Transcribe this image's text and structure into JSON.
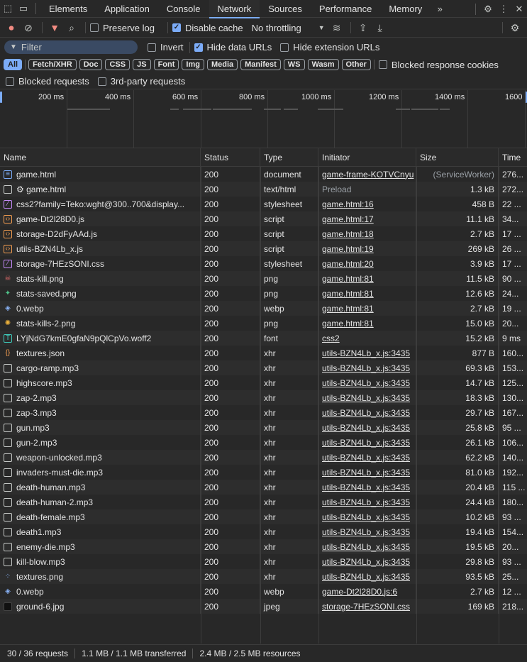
{
  "devtools": {
    "tabs": [
      "Elements",
      "Application",
      "Console",
      "Network",
      "Sources",
      "Performance",
      "Memory"
    ],
    "active_tab": "Network",
    "more_tabs_icon": "»"
  },
  "toolbar": {
    "preserve_log": "Preserve log",
    "disable_cache": "Disable cache",
    "throttling": "No throttling"
  },
  "filter": {
    "placeholder": "Filter",
    "invert": "Invert",
    "hide_data_urls": "Hide data URLs",
    "hide_extension_urls": "Hide extension URLs"
  },
  "type_filters": [
    "All",
    "Fetch/XHR",
    "Doc",
    "CSS",
    "JS",
    "Font",
    "Img",
    "Media",
    "Manifest",
    "WS",
    "Wasm",
    "Other"
  ],
  "blocked_response_cookies": "Blocked response cookies",
  "blocked_requests": "Blocked requests",
  "third_party_requests": "3rd-party requests",
  "timeline": {
    "ticks": [
      "200 ms",
      "400 ms",
      "600 ms",
      "800 ms",
      "1000 ms",
      "1200 ms",
      "1400 ms",
      "1600"
    ]
  },
  "columns": {
    "name": "Name",
    "status": "Status",
    "type": "Type",
    "initiator": "Initiator",
    "size": "Size",
    "time": "Time"
  },
  "requests": [
    {
      "icon": "document-icon",
      "name": "game.html",
      "status": "200",
      "type": "document",
      "initiator": "game-frame-KOTVCnyu",
      "initiator_link": true,
      "size": "(ServiceWorker)",
      "size_muted": true,
      "time": "276..."
    },
    {
      "icon": "gear-icon",
      "name": "⚙ game.html",
      "status": "200",
      "type": "text/html",
      "initiator": "Preload",
      "initiator_link": false,
      "size": "1.3 kB",
      "size_muted": false,
      "time": "272..."
    },
    {
      "icon": "stylesheet-icon",
      "name": "css2?family=Teko:wght@300..700&display...",
      "status": "200",
      "type": "stylesheet",
      "initiator": "game.html:16",
      "initiator_link": true,
      "size": "458 B",
      "size_muted": false,
      "time": "22 ..."
    },
    {
      "icon": "script-icon",
      "name": "game-Dt2l28D0.js",
      "status": "200",
      "type": "script",
      "initiator": "game.html:17",
      "initiator_link": true,
      "size": "11.1 kB",
      "size_muted": false,
      "time": "34..."
    },
    {
      "icon": "script-icon",
      "name": "storage-D2dFyAAd.js",
      "status": "200",
      "type": "script",
      "initiator": "game.html:18",
      "initiator_link": true,
      "size": "2.7 kB",
      "size_muted": false,
      "time": "17 ..."
    },
    {
      "icon": "script-icon",
      "name": "utils-BZN4Lb_x.js",
      "status": "200",
      "type": "script",
      "initiator": "game.html:19",
      "initiator_link": true,
      "size": "269 kB",
      "size_muted": false,
      "time": "26 ..."
    },
    {
      "icon": "stylesheet-icon",
      "name": "storage-7HEzSONI.css",
      "status": "200",
      "type": "stylesheet",
      "initiator": "game.html:20",
      "initiator_link": true,
      "size": "3.9 kB",
      "size_muted": false,
      "time": "17 ..."
    },
    {
      "icon": "image-red-icon",
      "name": "stats-kill.png",
      "status": "200",
      "type": "png",
      "initiator": "game.html:81",
      "initiator_link": true,
      "size": "11.5 kB",
      "size_muted": false,
      "time": "90 ..."
    },
    {
      "icon": "image-green-icon",
      "name": "stats-saved.png",
      "status": "200",
      "type": "png",
      "initiator": "game.html:81",
      "initiator_link": true,
      "size": "12.6 kB",
      "size_muted": false,
      "time": "24..."
    },
    {
      "icon": "image-blue-icon",
      "name": "0.webp",
      "status": "200",
      "type": "webp",
      "initiator": "game.html:81",
      "initiator_link": true,
      "size": "2.7 kB",
      "size_muted": false,
      "time": "19 ..."
    },
    {
      "icon": "image-yellow-icon",
      "name": "stats-kills-2.png",
      "status": "200",
      "type": "png",
      "initiator": "game.html:81",
      "initiator_link": true,
      "size": "15.0 kB",
      "size_muted": false,
      "time": "20..."
    },
    {
      "icon": "font-icon",
      "name": "LYjNdG7kmE0gfaN9pQlCpVo.woff2",
      "status": "200",
      "type": "font",
      "initiator": "css2",
      "initiator_link": true,
      "size": "15.2 kB",
      "size_muted": false,
      "time": "9 ms"
    },
    {
      "icon": "json-icon",
      "name": "textures.json",
      "status": "200",
      "type": "xhr",
      "initiator": "utils-BZN4Lb_x.js:3435",
      "initiator_link": true,
      "size": "877 B",
      "size_muted": false,
      "time": "160..."
    },
    {
      "icon": "file-icon",
      "name": "cargo-ramp.mp3",
      "status": "200",
      "type": "xhr",
      "initiator": "utils-BZN4Lb_x.js:3435",
      "initiator_link": true,
      "size": "69.3 kB",
      "size_muted": false,
      "time": "153..."
    },
    {
      "icon": "file-icon",
      "name": "highscore.mp3",
      "status": "200",
      "type": "xhr",
      "initiator": "utils-BZN4Lb_x.js:3435",
      "initiator_link": true,
      "size": "14.7 kB",
      "size_muted": false,
      "time": "125..."
    },
    {
      "icon": "file-icon",
      "name": "zap-2.mp3",
      "status": "200",
      "type": "xhr",
      "initiator": "utils-BZN4Lb_x.js:3435",
      "initiator_link": true,
      "size": "18.3 kB",
      "size_muted": false,
      "time": "130..."
    },
    {
      "icon": "file-icon",
      "name": "zap-3.mp3",
      "status": "200",
      "type": "xhr",
      "initiator": "utils-BZN4Lb_x.js:3435",
      "initiator_link": true,
      "size": "29.7 kB",
      "size_muted": false,
      "time": "167..."
    },
    {
      "icon": "file-icon",
      "name": "gun.mp3",
      "status": "200",
      "type": "xhr",
      "initiator": "utils-BZN4Lb_x.js:3435",
      "initiator_link": true,
      "size": "25.8 kB",
      "size_muted": false,
      "time": "95 ..."
    },
    {
      "icon": "file-icon",
      "name": "gun-2.mp3",
      "status": "200",
      "type": "xhr",
      "initiator": "utils-BZN4Lb_x.js:3435",
      "initiator_link": true,
      "size": "26.1 kB",
      "size_muted": false,
      "time": "106..."
    },
    {
      "icon": "file-icon",
      "name": "weapon-unlocked.mp3",
      "status": "200",
      "type": "xhr",
      "initiator": "utils-BZN4Lb_x.js:3435",
      "initiator_link": true,
      "size": "62.2 kB",
      "size_muted": false,
      "time": "140..."
    },
    {
      "icon": "file-icon",
      "name": "invaders-must-die.mp3",
      "status": "200",
      "type": "xhr",
      "initiator": "utils-BZN4Lb_x.js:3435",
      "initiator_link": true,
      "size": "81.0 kB",
      "size_muted": false,
      "time": "192..."
    },
    {
      "icon": "file-icon",
      "name": "death-human.mp3",
      "status": "200",
      "type": "xhr",
      "initiator": "utils-BZN4Lb_x.js:3435",
      "initiator_link": true,
      "size": "20.4 kB",
      "size_muted": false,
      "time": "115 ..."
    },
    {
      "icon": "file-icon",
      "name": "death-human-2.mp3",
      "status": "200",
      "type": "xhr",
      "initiator": "utils-BZN4Lb_x.js:3435",
      "initiator_link": true,
      "size": "24.4 kB",
      "size_muted": false,
      "time": "180..."
    },
    {
      "icon": "file-icon",
      "name": "death-female.mp3",
      "status": "200",
      "type": "xhr",
      "initiator": "utils-BZN4Lb_x.js:3435",
      "initiator_link": true,
      "size": "10.2 kB",
      "size_muted": false,
      "time": "93 ..."
    },
    {
      "icon": "file-icon",
      "name": "death1.mp3",
      "status": "200",
      "type": "xhr",
      "initiator": "utils-BZN4Lb_x.js:3435",
      "initiator_link": true,
      "size": "19.4 kB",
      "size_muted": false,
      "time": "154..."
    },
    {
      "icon": "file-icon",
      "name": "enemy-die.mp3",
      "status": "200",
      "type": "xhr",
      "initiator": "utils-BZN4Lb_x.js:3435",
      "initiator_link": true,
      "size": "19.5 kB",
      "size_muted": false,
      "time": "20..."
    },
    {
      "icon": "file-icon",
      "name": "kill-blow.mp3",
      "status": "200",
      "type": "xhr",
      "initiator": "utils-BZN4Lb_x.js:3435",
      "initiator_link": true,
      "size": "29.8 kB",
      "size_muted": false,
      "time": "93 ..."
    },
    {
      "icon": "image-sprite-icon",
      "name": "textures.png",
      "status": "200",
      "type": "xhr",
      "initiator": "utils-BZN4Lb_x.js:3435",
      "initiator_link": true,
      "size": "93.5 kB",
      "size_muted": false,
      "time": "25..."
    },
    {
      "icon": "image-blue-icon",
      "name": "0.webp",
      "status": "200",
      "type": "webp",
      "initiator": "game-Dt2l28D0.js:6",
      "initiator_link": true,
      "size": "2.7 kB",
      "size_muted": false,
      "time": "12 ..."
    },
    {
      "icon": "image-dark-icon",
      "name": "ground-6.jpg",
      "status": "200",
      "type": "jpeg",
      "initiator": "storage-7HEzSONI.css",
      "initiator_link": true,
      "size": "169 kB",
      "size_muted": false,
      "time": "218..."
    }
  ],
  "summary": {
    "requests": "30 / 36 requests",
    "transferred": "1.1 MB / 1.1 MB transferred",
    "resources": "2.4 MB / 2.5 MB resources"
  }
}
